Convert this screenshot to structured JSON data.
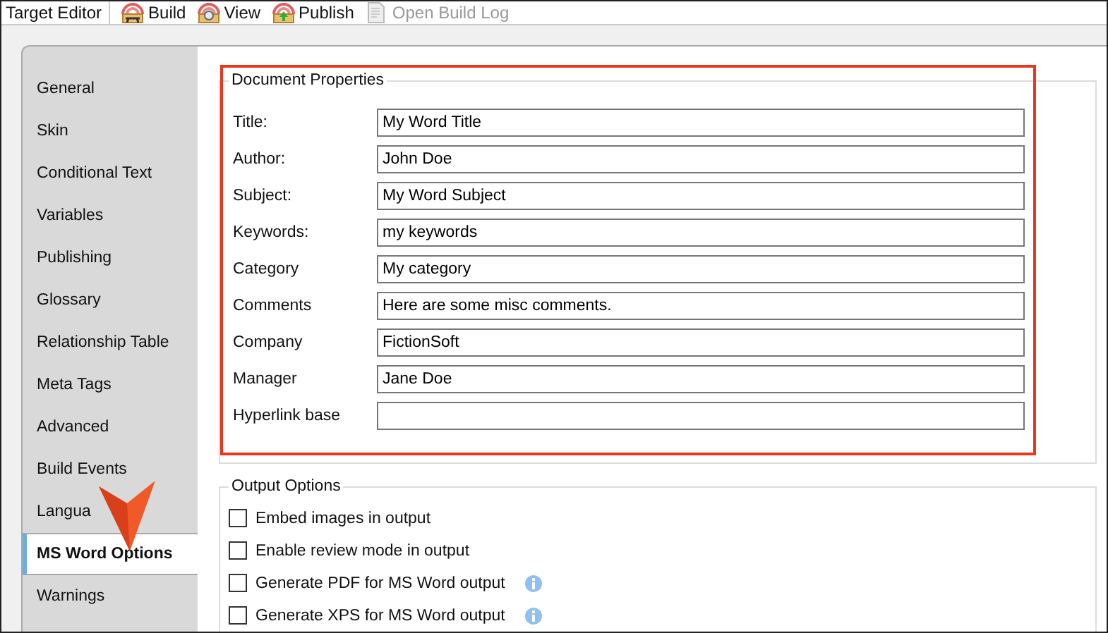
{
  "toolbar": {
    "title": "Target Editor",
    "buttons": [
      {
        "label": "Build",
        "kind": "build",
        "disabled": false
      },
      {
        "label": "View",
        "kind": "view",
        "disabled": false
      },
      {
        "label": "Publish",
        "kind": "publish",
        "disabled": false
      },
      {
        "label": "Open Build Log",
        "kind": "log",
        "disabled": true
      }
    ]
  },
  "tabs": [
    {
      "label": "General",
      "selected": false
    },
    {
      "label": "Skin",
      "selected": false
    },
    {
      "label": "Conditional Text",
      "selected": false
    },
    {
      "label": "Variables",
      "selected": false
    },
    {
      "label": "Publishing",
      "selected": false
    },
    {
      "label": "Glossary",
      "selected": false
    },
    {
      "label": "Relationship Table",
      "selected": false
    },
    {
      "label": "Meta Tags",
      "selected": false
    },
    {
      "label": "Advanced",
      "selected": false
    },
    {
      "label": "Build Events",
      "selected": false
    },
    {
      "label": "Langua",
      "selected": false
    },
    {
      "label": "MS Word Options",
      "selected": true
    },
    {
      "label": "Warnings",
      "selected": false
    }
  ],
  "document_properties": {
    "title": "Document Properties",
    "fields": [
      {
        "label": "Title:",
        "value": "My Word Title"
      },
      {
        "label": "Author:",
        "value": "John Doe"
      },
      {
        "label": "Subject:",
        "value": "My Word Subject"
      },
      {
        "label": "Keywords:",
        "value": "my keywords"
      },
      {
        "label": "Category",
        "value": "My category"
      },
      {
        "label": "Comments",
        "value": "Here are some misc comments."
      },
      {
        "label": "Company",
        "value": "FictionSoft"
      },
      {
        "label": "Manager",
        "value": "Jane Doe"
      },
      {
        "label": "Hyperlink base"
      }
    ]
  },
  "output_options": {
    "title": "Output Options",
    "options": [
      {
        "label": "Embed images in output",
        "checked": false,
        "info": false
      },
      {
        "label": "Enable review mode in output",
        "checked": false,
        "info": false
      },
      {
        "label": "Generate PDF for MS Word output",
        "checked": false,
        "info": true
      },
      {
        "label": "Generate XPS for MS Word output",
        "checked": false,
        "info": true
      }
    ]
  }
}
